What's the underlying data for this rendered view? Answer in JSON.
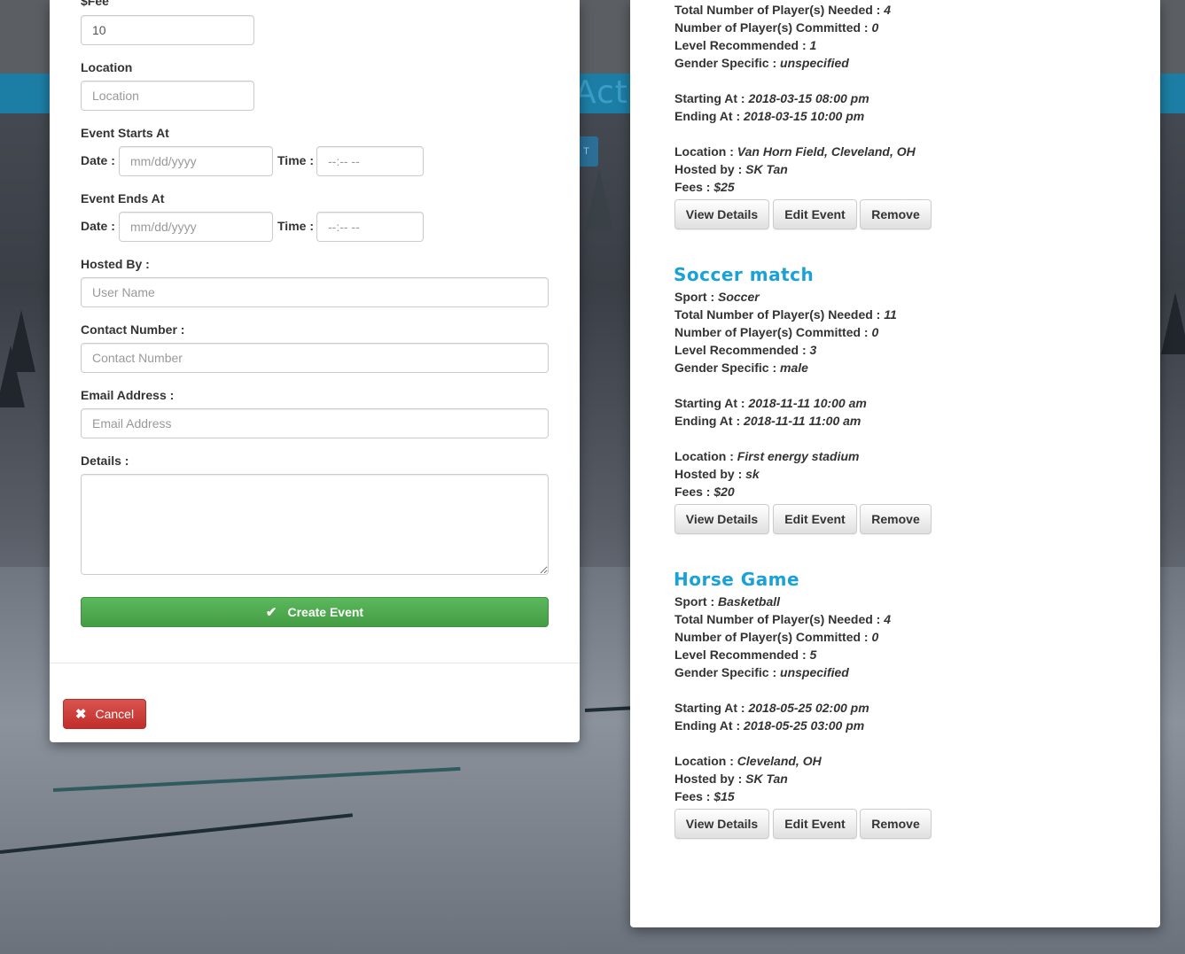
{
  "form": {
    "fee": {
      "label": "$Fee",
      "value": "10"
    },
    "location": {
      "label": "Location",
      "placeholder": "Location"
    },
    "starts": {
      "label": "Event Starts At",
      "date_label": "Date :",
      "date_placeholder": "mm/dd/yyyy",
      "time_label": "Time :",
      "time_placeholder": "--:-- --"
    },
    "ends": {
      "label": "Event Ends At",
      "date_label": "Date :",
      "date_placeholder": "mm/dd/yyyy",
      "time_label": "Time :",
      "time_placeholder": "--:-- --"
    },
    "hosted_by": {
      "label": "Hosted By :",
      "placeholder": "User Name"
    },
    "contact": {
      "label": "Contact Number :",
      "placeholder": "Contact Number"
    },
    "email": {
      "label": "Email Address :",
      "placeholder": "Email Address"
    },
    "details": {
      "label": "Details :"
    },
    "create_button": "Create Event",
    "cancel_button": "Cancel"
  },
  "background": {
    "heading_fragment": "Acti",
    "button_fragment": "T"
  },
  "events": [
    {
      "title": "",
      "lines": [
        {
          "label": "Total Number of Player(s) Needed : ",
          "value": "4"
        },
        {
          "label": "Number of Player(s) Committed : ",
          "value": "0"
        },
        {
          "label": "Level Recommended : ",
          "value": "1"
        },
        {
          "label": "Gender Specific : ",
          "value": "unspecified"
        }
      ],
      "starting_label": "Starting At : ",
      "starting": "2018-03-15 08:00 pm",
      "ending_label": "Ending At : ",
      "ending": "2018-03-15 10:00 pm",
      "location_label": "Location : ",
      "location": "Van Horn Field, Cleveland, OH",
      "hosted_label": "Hosted by : ",
      "hosted": "SK Tan",
      "fees_label": "Fees : ",
      "fees": "$25"
    },
    {
      "title": "Soccer match",
      "lines": [
        {
          "label": "Sport : ",
          "value": "Soccer"
        },
        {
          "label": "Total Number of Player(s) Needed : ",
          "value": "11"
        },
        {
          "label": "Number of Player(s) Committed : ",
          "value": "0"
        },
        {
          "label": "Level Recommended : ",
          "value": "3"
        },
        {
          "label": "Gender Specific : ",
          "value": "male"
        }
      ],
      "starting_label": "Starting At : ",
      "starting": "2018-11-11 10:00 am",
      "ending_label": "Ending At : ",
      "ending": "2018-11-11 11:00 am",
      "location_label": "Location : ",
      "location": "First energy stadium",
      "hosted_label": "Hosted by : ",
      "hosted": "sk",
      "fees_label": "Fees : ",
      "fees": "$20"
    },
    {
      "title": "Horse Game",
      "lines": [
        {
          "label": "Sport : ",
          "value": "Basketball"
        },
        {
          "label": "Total Number of Player(s) Needed : ",
          "value": "4"
        },
        {
          "label": "Number of Player(s) Committed : ",
          "value": "0"
        },
        {
          "label": "Level Recommended : ",
          "value": "5"
        },
        {
          "label": "Gender Specific : ",
          "value": "unspecified"
        }
      ],
      "starting_label": "Starting At : ",
      "starting": "2018-05-25 02:00 pm",
      "ending_label": "Ending At : ",
      "ending": "2018-05-25 03:00 pm",
      "location_label": "Location : ",
      "location": "Cleveland, OH",
      "hosted_label": "Hosted by : ",
      "hosted": "SK Tan",
      "fees_label": "Fees : ",
      "fees": "$15"
    }
  ],
  "event_buttons": {
    "view": "View Details",
    "edit": "Edit Event",
    "remove": "Remove"
  },
  "colors": {
    "accent": "#1aa2d8",
    "success": "#5cb85c",
    "danger": "#d9534f"
  }
}
